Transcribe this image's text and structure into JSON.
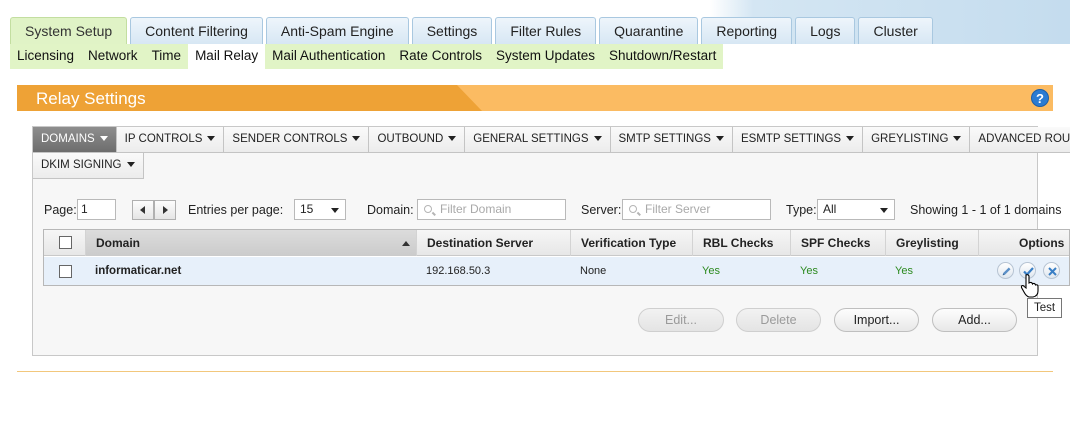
{
  "main_tabs": [
    "System Setup",
    "Content Filtering",
    "Anti-Spam Engine",
    "Settings",
    "Filter Rules",
    "Quarantine",
    "Reporting",
    "Logs",
    "Cluster"
  ],
  "sub_nav": [
    "Licensing",
    "Network",
    "Time",
    "Mail Relay",
    "Mail Authentication",
    "Rate Controls",
    "System Updates",
    "Shutdown/Restart"
  ],
  "panel": {
    "title": "Relay Settings",
    "help": "?"
  },
  "category_tabs": [
    "DOMAINS",
    "IP CONTROLS",
    "SENDER CONTROLS",
    "OUTBOUND",
    "GENERAL SETTINGS",
    "SMTP SETTINGS",
    "ESMTP SETTINGS",
    "GREYLISTING",
    "ADVANCED ROUTING",
    "DKIM SIGNING"
  ],
  "controls": {
    "page_label": "Page:",
    "page_value": "1",
    "entries_label": "Entries per page:",
    "entries_value": "15",
    "domain_label": "Domain:",
    "domain_placeholder": "Filter Domain",
    "server_label": "Server:",
    "server_placeholder": "Filter Server",
    "type_label": "Type:",
    "type_value": "All",
    "showing": "Showing 1 - 1 of 1 domains"
  },
  "table": {
    "columns": [
      "Domain",
      "Destination Server",
      "Verification Type",
      "RBL Checks",
      "SPF Checks",
      "Greylisting",
      "Options"
    ],
    "rows": [
      {
        "domain": "informaticar.net",
        "server": "192.168.50.3",
        "verification": "None",
        "rbl": "Yes",
        "spf": "Yes",
        "greylisting": "Yes"
      }
    ]
  },
  "tooltip": "Test",
  "buttons": {
    "edit": "Edit...",
    "delete": "Delete",
    "import": "Import...",
    "add": "Add..."
  },
  "colors": {
    "accent_orange": "#eea236",
    "tab_green": "#e1f4c6",
    "row_highlight": "#e7f0fa",
    "yes_green": "#2c8a1f"
  },
  "icons": {
    "help": "help-icon",
    "edit": "pencil-icon",
    "test": "check-icon",
    "delete": "x-icon",
    "cursor": "hand-pointer-icon"
  }
}
